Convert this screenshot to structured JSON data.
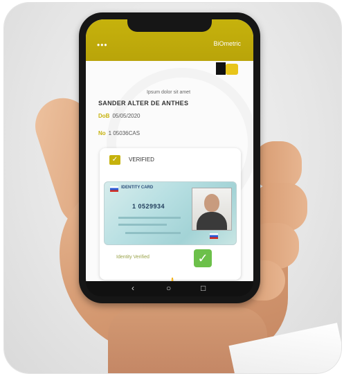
{
  "app": {
    "menu_dots": "•••",
    "header_title": "BiOmetric",
    "logo_caption": "",
    "small_line": "Ipsum dolor sit amet",
    "name": "SANDER ALTER DE ANTHES",
    "dob_label": "DoB",
    "dob_value": "05/05/2020",
    "id_label": "No",
    "id_value": "1 05036CAS",
    "card": {
      "check_label": "VERIFIED",
      "id_title": "IDENTITY CARD",
      "id_number": "1 0529934",
      "status_text": "Identity Verified",
      "ok_mark": "✓"
    },
    "touch_icon": "☝"
  },
  "navbar": {
    "back": "‹",
    "home": "○",
    "recent": "□"
  },
  "colors": {
    "accent": "#c6b20c",
    "success": "#6cc04a"
  },
  "icons": {
    "menu": "menu-dots-icon",
    "logo": "logo-icon",
    "check": "check-icon",
    "touch": "touch-icon",
    "nav_back": "back-icon",
    "nav_home": "home-icon",
    "nav_recent": "recent-apps-icon"
  }
}
